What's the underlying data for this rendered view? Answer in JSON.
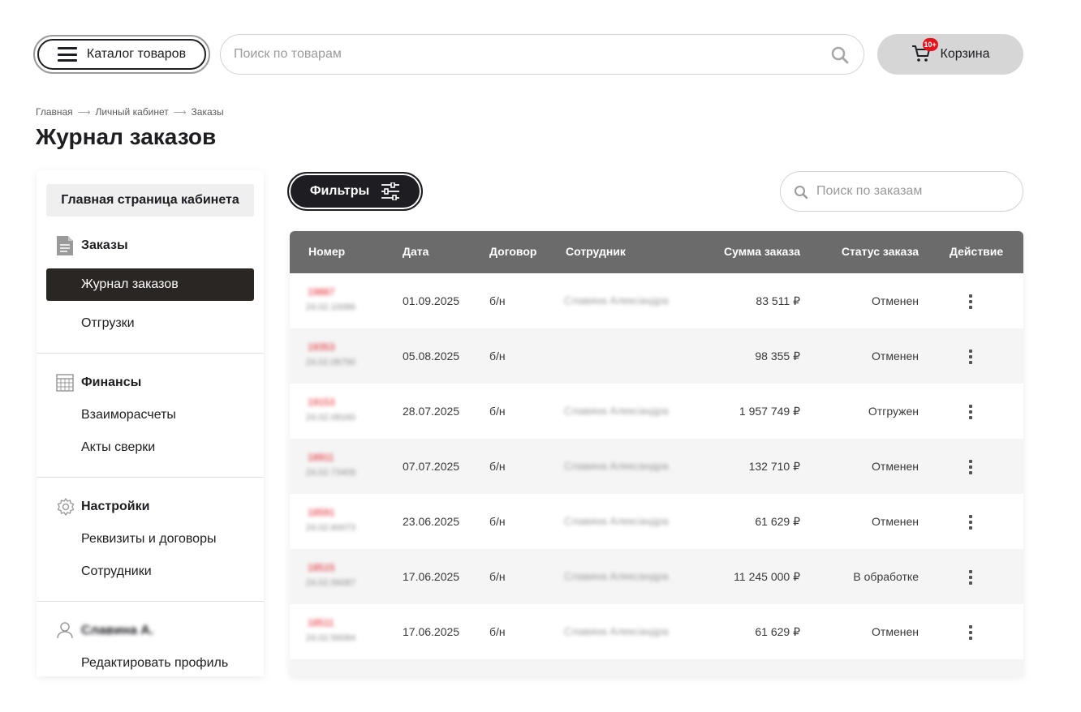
{
  "header": {
    "catalog_label": "Каталог товаров",
    "search_placeholder": "Поиск по товарам",
    "cart_label": "Корзина",
    "cart_badge": "10+",
    "badge_color": "#e3141e"
  },
  "breadcrumb": [
    "Главная",
    "Личный кабинет",
    "Заказы"
  ],
  "page_title": "Журнал заказов",
  "sidebar": {
    "home_label": "Главная страница кабинета",
    "orders": {
      "title": "Заказы",
      "items": [
        "Журнал заказов",
        "Отгрузки"
      ],
      "active": "Журнал заказов"
    },
    "finance": {
      "title": "Финансы",
      "items": [
        "Взаиморасчеты",
        "Акты сверки"
      ]
    },
    "settings": {
      "title": "Настройки",
      "items": [
        "Реквизиты и договоры",
        "Сотрудники"
      ]
    },
    "profile": {
      "name": "Славина А.",
      "items": [
        "Редактировать профиль"
      ]
    }
  },
  "toolbar": {
    "filters_label": "Фильтры",
    "orders_search_placeholder": "Поиск по заказам"
  },
  "table": {
    "columns": [
      "Номер",
      "Дата",
      "Договор",
      "Сотрудник",
      "Сумма заказа",
      "Статус заказа",
      "Действие"
    ],
    "rows": [
      {
        "number": "19887",
        "number_sub": "24.02.10086",
        "date": "01.09.2025",
        "contract": "б/н",
        "employee": "Славина Александра",
        "amount": "83 511 ₽",
        "status": "Отменен"
      },
      {
        "number": "19353",
        "number_sub": "24.02.08790",
        "date": "05.08.2025",
        "contract": "б/н",
        "employee": "",
        "amount": "98 355 ₽",
        "status": "Отменен"
      },
      {
        "number": "19153",
        "number_sub": "24.02.08160",
        "date": "28.07.2025",
        "contract": "б/н",
        "employee": "Славина Александра",
        "amount": "1 957 749 ₽",
        "status": "Отгружен"
      },
      {
        "number": "18911",
        "number_sub": "24.02.73409",
        "date": "07.07.2025",
        "contract": "б/н",
        "employee": "Славина Александра",
        "amount": "132 710 ₽",
        "status": "Отменен"
      },
      {
        "number": "18591",
        "number_sub": "24.02.60073",
        "date": "23.06.2025",
        "contract": "б/н",
        "employee": "Славина Александра",
        "amount": "61 629 ₽",
        "status": "Отменен"
      },
      {
        "number": "18515",
        "number_sub": "24.02.56087",
        "date": "17.06.2025",
        "contract": "б/н",
        "employee": "Славина Александра",
        "amount": "11 245 000 ₽",
        "status": "В обработке"
      },
      {
        "number": "18511",
        "number_sub": "24.02.56084",
        "date": "17.06.2025",
        "contract": "б/н",
        "employee": "Славина Александра",
        "amount": "61 629 ₽",
        "status": "Отменен"
      }
    ]
  }
}
